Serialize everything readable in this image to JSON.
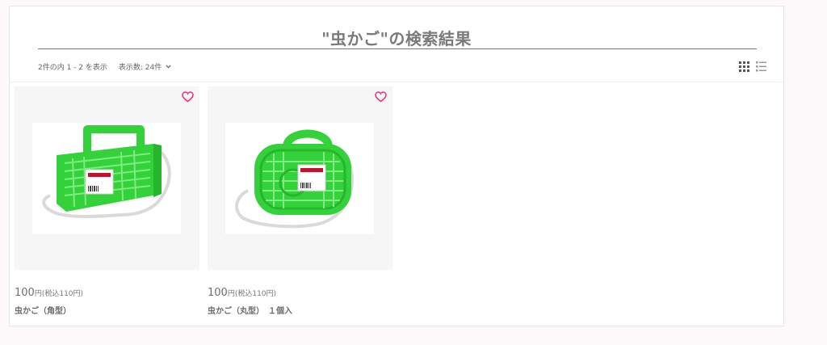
{
  "search": {
    "title": "\"虫かご\"の検索結果",
    "result_summary": "2件の内 1 - 2 を表示",
    "per_page_label": "表示数: 24件"
  },
  "view_modes": [
    "grid-view-icon",
    "list-view-icon"
  ],
  "colors": {
    "accent_pink": "#e8318c",
    "basket_green": "#34d23a"
  },
  "products": [
    {
      "price": "100",
      "price_unit": "円",
      "price_tax": "(税込110円)",
      "name": "虫かご（角型）",
      "image": "square-green-bug-basket"
    },
    {
      "price": "100",
      "price_unit": "円",
      "price_tax": "(税込110円)",
      "name": "虫かご（丸型）　１個入",
      "image": "round-green-bug-basket"
    }
  ]
}
